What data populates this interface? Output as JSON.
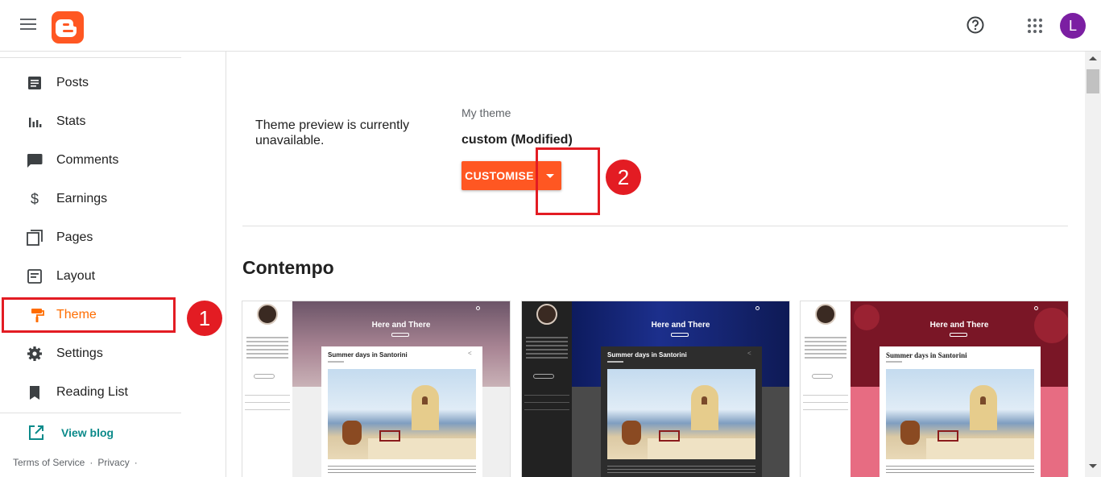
{
  "header": {
    "menu_icon": "hamburger-menu-icon",
    "logo_icon": "blogger-logo-icon",
    "help_icon": "help-circle-icon",
    "apps_icon": "apps-grid-icon",
    "avatar_letter": "L",
    "avatar_color": "#7b1fa2",
    "brand_color": "#ff5722"
  },
  "sidebar": {
    "items": [
      {
        "label": "Posts",
        "icon": "posts-icon"
      },
      {
        "label": "Stats",
        "icon": "stats-icon"
      },
      {
        "label": "Comments",
        "icon": "comments-icon"
      },
      {
        "label": "Earnings",
        "icon": "dollar-icon"
      },
      {
        "label": "Pages",
        "icon": "pages-icon"
      },
      {
        "label": "Layout",
        "icon": "layout-icon"
      },
      {
        "label": "Theme",
        "icon": "paint-roller-icon",
        "active": true
      },
      {
        "label": "Settings",
        "icon": "gear-icon"
      },
      {
        "label": "Reading List",
        "icon": "bookmark-icon"
      }
    ],
    "view_blog": "View blog",
    "terms": "Terms of Service",
    "privacy": "Privacy",
    "separator": "·",
    "active_color": "#ff6d00"
  },
  "annotations": {
    "step1": "1",
    "step2": "2",
    "highlight_color": "#e31c23"
  },
  "main": {
    "preview_note": "Theme preview is currently unavailable.",
    "my_theme_label": "My theme",
    "theme_name": "custom (Modified)",
    "customise_button": "CUSTOMISE",
    "dropdown_icon": "caret-down-icon",
    "section_title": "Contempo",
    "cards": [
      {
        "blog_title": "Here and There",
        "post_title": "Summer days in Santorini"
      },
      {
        "blog_title": "Here and There",
        "post_title": "Summer days in Santorini"
      },
      {
        "blog_title": "Here and There",
        "post_title": "Summer days in Santorini"
      }
    ]
  }
}
